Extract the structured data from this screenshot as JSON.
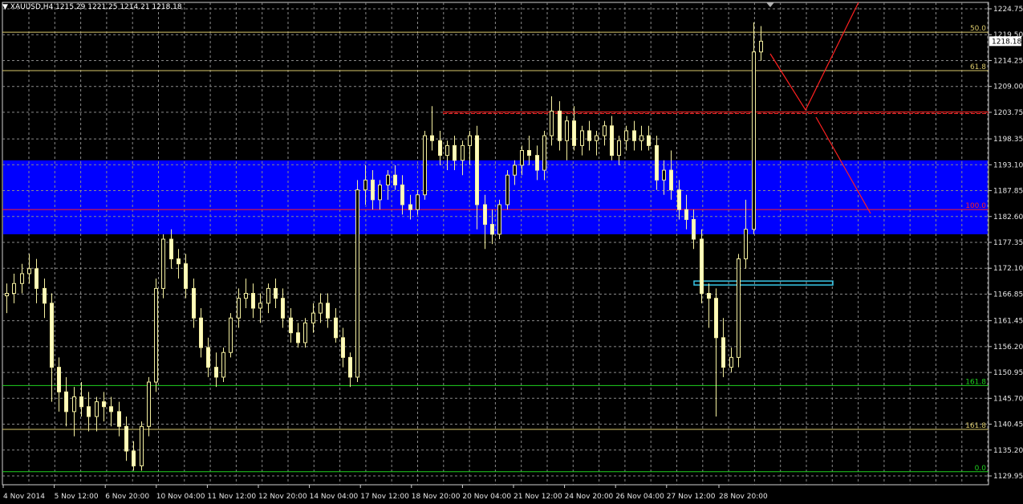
{
  "header": {
    "symbol": "XAUUSD,H4",
    "ohlc": "1215.29 1221.25 1214.21 1218.18"
  },
  "chart_data": {
    "type": "candlestick",
    "symbol": "XAUUSD",
    "timeframe": "H4",
    "ylim": [
      1129.95,
      1224.75
    ],
    "grid": true,
    "current_price": "1218.18",
    "y_tick_labels": [
      "1224.75",
      "1219.50",
      "1214.25",
      "1209.00",
      "1203.75",
      "1198.35",
      "1193.10",
      "1187.85",
      "1182.60",
      "1177.35",
      "1172.10",
      "1166.85",
      "1161.45",
      "1156.20",
      "1150.95",
      "1145.70",
      "1140.45",
      "1135.20",
      "1129.95"
    ],
    "x_tick_labels": [
      "4 Nov 2014",
      "5 Nov 12:00",
      "6 Nov 20:00",
      "10 Nov 04:00",
      "11 Nov 12:00",
      "12 Nov 20:00",
      "14 Nov 04:00",
      "17 Nov 12:00",
      "18 Nov 20:00",
      "20 Nov 04:00",
      "21 Nov 12:00",
      "24 Nov 20:00",
      "26 Nov 04:00",
      "27 Nov 12:00",
      "28 Nov 20:00"
    ],
    "zone": {
      "from": 1179.0,
      "to": 1194.0,
      "color": "#0000ff"
    },
    "levels": [
      {
        "price": 1220.0,
        "label": "50.0",
        "color": "#d9c86a"
      },
      {
        "price": 1212.2,
        "label": "61.8",
        "color": "#d9c86a"
      },
      {
        "price": 1184.0,
        "label": "100.0",
        "color": "#ff2020"
      },
      {
        "price": 1148.3,
        "label": "161.8",
        "color": "#1fd11f"
      },
      {
        "price": 1139.4,
        "label": "161.8",
        "color": "#d9c86a"
      },
      {
        "price": 1130.8,
        "label": "0.0",
        "color": "#1fd11f"
      }
    ],
    "resistance": {
      "price": 1203.5,
      "color": "#ff2020"
    },
    "support_box": {
      "top": 1169.5,
      "bottom": 1168.7,
      "color": "#39c6e6"
    },
    "candles": [
      [
        1166.5,
        1169,
        1163,
        1167
      ],
      [
        1167,
        1171,
        1165,
        1169
      ],
      [
        1169,
        1173,
        1167,
        1171
      ],
      [
        1171,
        1175,
        1169,
        1172
      ],
      [
        1172,
        1174,
        1165,
        1168
      ],
      [
        1168,
        1170,
        1162,
        1165
      ],
      [
        1165,
        1167,
        1145,
        1152
      ],
      [
        1152,
        1154,
        1143,
        1147
      ],
      [
        1147,
        1150,
        1140,
        1143
      ],
      [
        1143,
        1148,
        1138,
        1146
      ],
      [
        1146,
        1149,
        1142,
        1144
      ],
      [
        1144,
        1147,
        1139,
        1142
      ],
      [
        1142,
        1146,
        1139,
        1145
      ],
      [
        1145,
        1147,
        1141,
        1144
      ],
      [
        1144,
        1146,
        1140,
        1143
      ],
      [
        1143,
        1145,
        1138,
        1140
      ],
      [
        1140,
        1142,
        1133,
        1135
      ],
      [
        1135,
        1137,
        1131,
        1132
      ],
      [
        1132,
        1141,
        1131,
        1140
      ],
      [
        1140,
        1150,
        1138,
        1149
      ],
      [
        1149,
        1170,
        1147,
        1168
      ],
      [
        1168,
        1179,
        1166,
        1178
      ],
      [
        1178,
        1180,
        1172,
        1174
      ],
      [
        1174,
        1176,
        1170,
        1173
      ],
      [
        1173,
        1175,
        1166,
        1168
      ],
      [
        1168,
        1170,
        1160,
        1162
      ],
      [
        1162,
        1164,
        1154,
        1156
      ],
      [
        1156,
        1158,
        1150,
        1152
      ],
      [
        1152,
        1155,
        1148,
        1150
      ],
      [
        1150,
        1156,
        1149,
        1155
      ],
      [
        1155,
        1163,
        1154,
        1162
      ],
      [
        1162,
        1168,
        1160,
        1166
      ],
      [
        1166,
        1170,
        1164,
        1167
      ],
      [
        1167,
        1169,
        1162,
        1164
      ],
      [
        1164,
        1167,
        1161,
        1165
      ],
      [
        1165,
        1169,
        1163,
        1168
      ],
      [
        1168,
        1170,
        1164,
        1166
      ],
      [
        1166,
        1168,
        1160,
        1162
      ],
      [
        1162,
        1164,
        1157,
        1159
      ],
      [
        1159,
        1161,
        1156,
        1157
      ],
      [
        1157,
        1162,
        1156,
        1161
      ],
      [
        1161,
        1165,
        1159,
        1163
      ],
      [
        1163,
        1167,
        1161,
        1165
      ],
      [
        1165,
        1167,
        1160,
        1162
      ],
      [
        1162,
        1164,
        1157,
        1158
      ],
      [
        1158,
        1160,
        1152,
        1154
      ],
      [
        1154,
        1155,
        1148,
        1150
      ],
      [
        1150,
        1190,
        1149,
        1188
      ],
      [
        1188,
        1193,
        1185,
        1190
      ],
      [
        1190,
        1192,
        1184,
        1186
      ],
      [
        1186,
        1190,
        1184,
        1189
      ],
      [
        1189,
        1192,
        1186,
        1191
      ],
      [
        1191,
        1193,
        1188,
        1189
      ],
      [
        1189,
        1191,
        1183,
        1185
      ],
      [
        1185,
        1187,
        1182,
        1184
      ],
      [
        1184,
        1188,
        1183,
        1187
      ],
      [
        1187,
        1200,
        1186,
        1199
      ],
      [
        1199,
        1205,
        1196,
        1198
      ],
      [
        1198,
        1200,
        1193,
        1195
      ],
      [
        1195,
        1198,
        1192,
        1197
      ],
      [
        1197,
        1199,
        1192,
        1194
      ],
      [
        1194,
        1198,
        1191,
        1197
      ],
      [
        1197,
        1200,
        1193,
        1199
      ],
      [
        1199,
        1201,
        1180,
        1185
      ],
      [
        1185,
        1187,
        1176,
        1181
      ],
      [
        1181,
        1184,
        1177,
        1179
      ],
      [
        1179,
        1186,
        1178,
        1185
      ],
      [
        1185,
        1192,
        1184,
        1191
      ],
      [
        1191,
        1194,
        1189,
        1193
      ],
      [
        1193,
        1197,
        1191,
        1196
      ],
      [
        1196,
        1199,
        1193,
        1195
      ],
      [
        1195,
        1197,
        1190,
        1192
      ],
      [
        1192,
        1200,
        1190,
        1199
      ],
      [
        1199,
        1207,
        1197,
        1204
      ],
      [
        1204,
        1206,
        1196,
        1198
      ],
      [
        1198,
        1203,
        1194,
        1202
      ],
      [
        1202,
        1205,
        1196,
        1197
      ],
      [
        1197,
        1201,
        1195,
        1200
      ],
      [
        1200,
        1202,
        1196,
        1198
      ],
      [
        1198,
        1200,
        1195,
        1199
      ],
      [
        1199,
        1202,
        1197,
        1201
      ],
      [
        1201,
        1203,
        1194,
        1195
      ],
      [
        1195,
        1199,
        1193,
        1198
      ],
      [
        1198,
        1201,
        1196,
        1200
      ],
      [
        1200,
        1202,
        1196,
        1198
      ],
      [
        1198,
        1201,
        1196,
        1199
      ],
      [
        1199,
        1201,
        1196,
        1197
      ],
      [
        1197,
        1199,
        1188,
        1190
      ],
      [
        1190,
        1194,
        1187,
        1192
      ],
      [
        1192,
        1196,
        1186,
        1188
      ],
      [
        1188,
        1190,
        1182,
        1184
      ],
      [
        1184,
        1187,
        1180,
        1182
      ],
      [
        1182,
        1184,
        1176,
        1178
      ],
      [
        1178,
        1180,
        1165,
        1167
      ],
      [
        1167,
        1169,
        1160,
        1166
      ],
      [
        1166,
        1168,
        1142,
        1158
      ],
      [
        1158,
        1162,
        1150,
        1152
      ],
      [
        1152,
        1156,
        1151,
        1154
      ],
      [
        1154,
        1175,
        1152,
        1174
      ],
      [
        1174,
        1186,
        1172,
        1180
      ],
      [
        1180,
        1222,
        1179,
        1216
      ],
      [
        1216,
        1221.25,
        1214.21,
        1218.18
      ]
    ],
    "annotation_path": [
      [
        1181.5,
        1216.5
      ],
      [
        1187,
        1209.5
      ],
      [
        1192.5,
        1203.5
      ]
    ],
    "annotation_segments": [
      {
        "from": [
          1187,
          1203
        ],
        "to": [
          1205,
          1226
        ]
      },
      {
        "from": [
          1192,
          1203
        ],
        "to": [
          1205,
          1184
        ]
      }
    ]
  }
}
